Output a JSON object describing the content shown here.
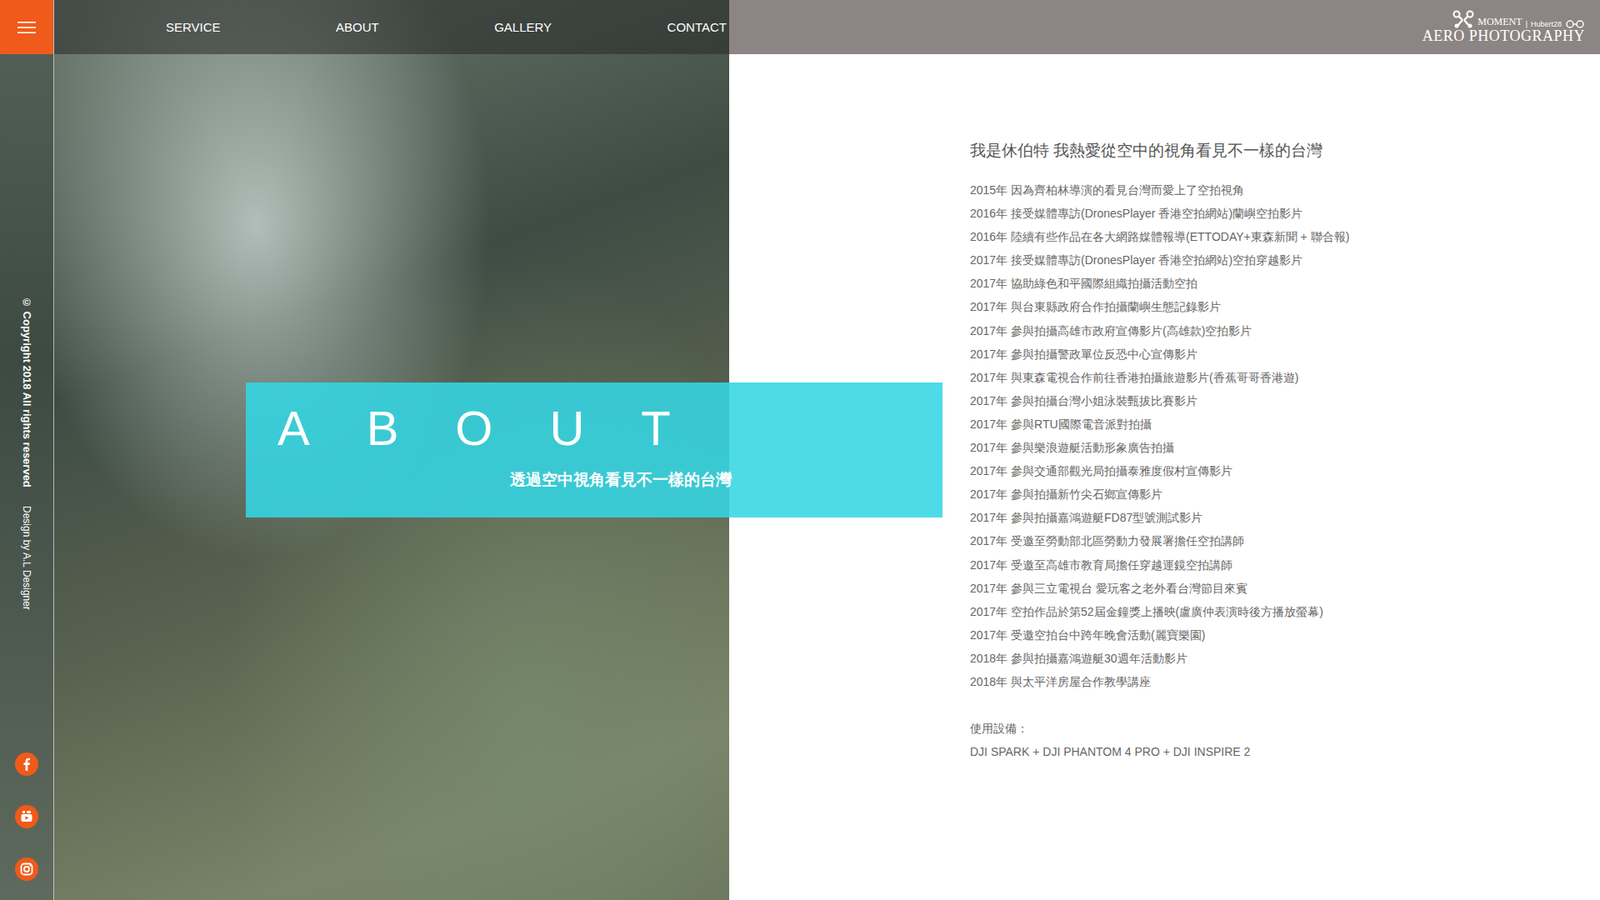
{
  "sidebar": {
    "copyright": "© Copyright 2018 All rights reserved",
    "credit": "Design by A.L Designer"
  },
  "nav": [
    "SERVICE",
    "ABOUT",
    "GALLERY",
    "CONTACT"
  ],
  "logo": {
    "brand": "MOMENT",
    "separator": "|",
    "sub": "Hubert28",
    "title": "AERO PHOTOGRAPHY"
  },
  "hero": {
    "title": "ABOUT",
    "subtitle": "透過空中視角看見不一樣的台灣"
  },
  "about": {
    "heading": "我是休伯特 我熱愛從空中的視角看見不一樣的台灣",
    "timeline": [
      {
        "year": "2015年",
        "text": "因為齊柏林導演的看見台灣而愛上了空拍視角"
      },
      {
        "year": "2016年",
        "text": "接受媒體專訪(DronesPlayer 香港空拍網站)蘭嶼空拍影片"
      },
      {
        "year": "2016年",
        "text": "陸續有些作品在各大網路媒體報導(ETTODAY+東森新聞 + 聯合報)"
      },
      {
        "year": "2017年",
        "text": "接受媒體專訪(DronesPlayer 香港空拍網站)空拍穿越影片"
      },
      {
        "year": "2017年",
        "text": "協助綠色和平國際組織拍攝活動空拍"
      },
      {
        "year": "2017年",
        "text": "與台東縣政府合作拍攝蘭嶼生態記錄影片"
      },
      {
        "year": "2017年",
        "text": "參與拍攝高雄市政府宣傳影片(高雄款)空拍影片"
      },
      {
        "year": "2017年",
        "text": "參與拍攝警政單位反恐中心宣傳影片"
      },
      {
        "year": "2017年",
        "text": "與東森電視合作前往香港拍攝旅遊影片(香蕉哥哥香港遊)"
      },
      {
        "year": "2017年",
        "text": "參與拍攝台灣小姐泳裝甄拔比賽影片"
      },
      {
        "year": "2017年",
        "text": "參與RTU國際電音派對拍攝"
      },
      {
        "year": "2017年",
        "text": "參與樂浪遊艇活動形象廣告拍攝"
      },
      {
        "year": "2017年",
        "text": "參與交通部觀光局拍攝泰雅度假村宣傳影片"
      },
      {
        "year": "2017年",
        "text": "參與拍攝新竹尖石鄉宣傳影片"
      },
      {
        "year": "2017年",
        "text": "參與拍攝嘉鴻遊艇FD87型號測試影片"
      },
      {
        "year": "2017年",
        "text": "受邀至勞動部北區勞動力發展署擔任空拍講師"
      },
      {
        "year": "2017年",
        "text": "受邀至高雄市教育局擔任穿越運鏡空拍講師"
      },
      {
        "year": "2017年",
        "text": "參與三立電視台 愛玩客之老外看台灣節目來賓"
      },
      {
        "year": "2017年",
        "text": "空拍作品於第52屆金鐘獎上播映(盧廣仲表演時後方播放螢幕)"
      },
      {
        "year": "2017年",
        "text": "受邀空拍台中跨年晚會活動(麗寶樂園)"
      },
      {
        "year": "2018年",
        "text": "參與拍攝嘉鴻遊艇30週年活動影片"
      },
      {
        "year": "2018年",
        "text": "與太平洋房屋合作教學講座"
      }
    ],
    "equipment_label": "使用設備：",
    "equipment": "DJI SPARK + DJI PHANTOM 4 PRO + DJI INSPIRE 2"
  }
}
